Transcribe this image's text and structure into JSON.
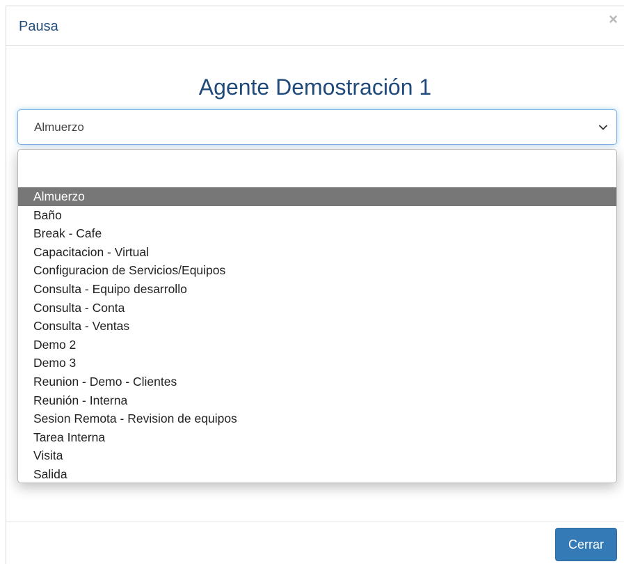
{
  "modal": {
    "title": "Pausa",
    "close_glyph": "×"
  },
  "agent": {
    "name": "Agente Demostración 1"
  },
  "select": {
    "selected_value": "Almuerzo",
    "focus_color": "#66afe9"
  },
  "options": [
    "Almuerzo",
    "Baño",
    "Break - Cafe",
    "Capacitacion - Virtual",
    "Configuracion de Servicios/Equipos",
    "Consulta - Equipo desarrollo",
    "Consulta - Conta",
    "Consulta - Ventas",
    "Demo 2",
    "Demo 3",
    "Reunion - Demo - Clientes",
    "Reunión - Interna",
    "Sesion Remota - Revision de equipos",
    "Tarea Interna",
    "Visita",
    "Salida"
  ],
  "footer": {
    "close_label": "Cerrar",
    "button_color": "#337ab7"
  },
  "colors": {
    "title": "#1f4a7a",
    "highlight": "#777777"
  }
}
